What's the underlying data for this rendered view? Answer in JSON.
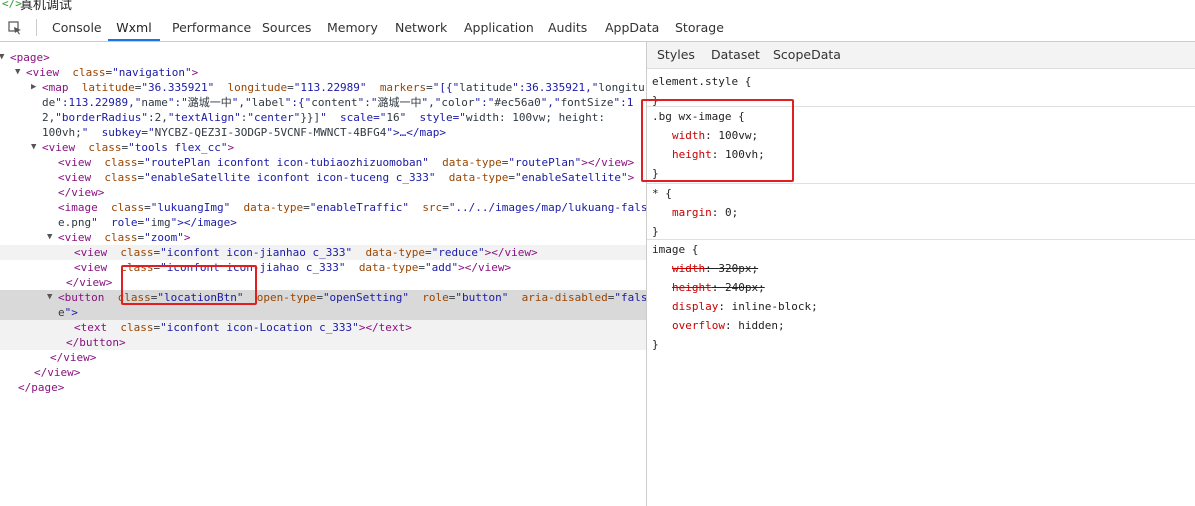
{
  "title": {
    "icon": "</>",
    "text": "真机调试"
  },
  "tabs": [
    "Console",
    "Wxml",
    "Performance",
    "Sources",
    "Memory",
    "Network",
    "Application",
    "Audits",
    "AppData",
    "Storage"
  ],
  "active_tab": "Wxml",
  "wxml": [
    "<page>",
    "<view  class=\"navigation\">",
    "<map  latitude=\"36.335921\"  longitude=\"113.22989\"  markers=\"[{\"latitude\":36.335921,\"longitu",
    "de\":113.22989,\"name\":\"潞城一中\",\"label\":{\"content\":\"潞城一中\",\"color\":\"#ec56a0\",\"fontSize\":1",
    "2,\"borderRadius\":2,\"textAlign\":\"center\"}}]\"  scale=\"16\"  style=\"width: 100vw; height:",
    "100vh;\"  subkey=\"NYCBZ-QEZ3I-3ODGP-5VCNF-MWNCT-4BFG4\">…</map>",
    "<view  class=\"tools flex_cc\">",
    "<view  class=\"routePlan iconfont icon-tubiaozhizuomoban\"  data-type=\"routePlan\"></view>",
    "<view  class=\"enableSatellite iconfont icon-tuceng c_333\"  data-type=\"enableSatellite\">",
    "</view>",
    "<image  class=\"lukuangImg\"  data-type=\"enableTraffic\"  src=\"../../images/map/lukuang-fals",
    "e.png\"  role=\"img\"></image>",
    "<view  class=\"zoom\">",
    "<view  class=\"iconfont icon-jianhao c_333\"  data-type=\"reduce\"></view>",
    "<view  class=\"iconfont icon-jiahao c_333\"  data-type=\"add\"></view>",
    "</view>",
    "<button  class=\"locationBtn\"  open-type=\"openSetting\"  role=\"button\"  aria-disabled=\"fals",
    "e\">",
    "<text  class=\"iconfont icon-Location c_333\"></text>",
    "</button>",
    "</view>",
    "</view>",
    "</page>"
  ],
  "styles_tabs": [
    "Styles",
    "Dataset",
    "ScopeData"
  ],
  "rules": [
    {
      "selector": "element.style {",
      "props": [],
      "close": "}"
    },
    {
      "selector": ".bg wx-image {",
      "props": [
        {
          "name": "width",
          "value": "100vw;"
        },
        {
          "name": "height",
          "value": "100vh;"
        }
      ],
      "close": "}"
    },
    {
      "selector": "* {",
      "props": [
        {
          "name": "margin",
          "value": "0;"
        }
      ],
      "close": "}"
    },
    {
      "selector": "image {",
      "props": [
        {
          "name": "width",
          "value": "320px;"
        },
        {
          "name": "height",
          "value": "240px;"
        },
        {
          "name": "display",
          "value": "inline-block;"
        },
        {
          "name": "overflow",
          "value": "hidden;"
        }
      ],
      "close": "}"
    }
  ],
  "colors": {
    "highlight_box": "#e02020",
    "active_tab_underline": "#1a73e8",
    "tag": "#881280",
    "attr_name": "#994500",
    "attr_value": "#1a1aa6",
    "css_prop": "#c80000"
  },
  "icons": [
    "code-icon",
    "inspect-icon",
    "triangle-down-icon",
    "triangle-right-icon"
  ]
}
